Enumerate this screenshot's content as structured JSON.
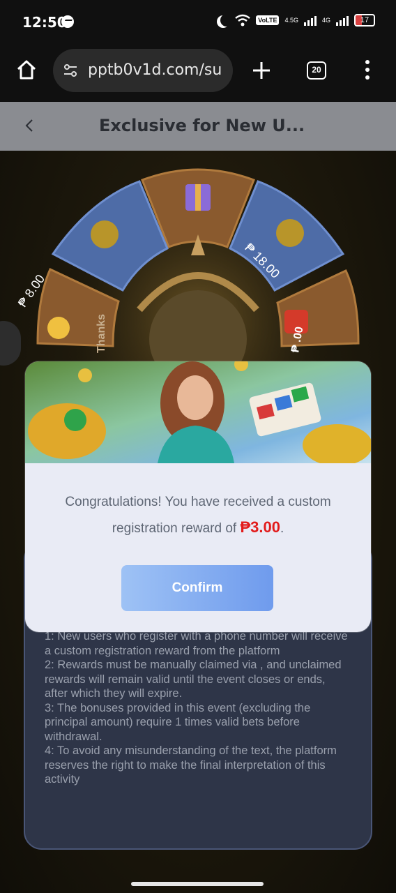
{
  "status_bar": {
    "time": "12:50",
    "volte": "VoLTE",
    "sim1_label": "4.5G",
    "sim2_label": "4G",
    "battery": "17"
  },
  "browser": {
    "url": "pptb0v1d.com/su",
    "tab_count": "20"
  },
  "header": {
    "title": "Exclusive for New U..."
  },
  "wheel": {
    "segments": [
      "₱ 8.00",
      "₱ 18.00",
      "Thanks",
      "₱ .00"
    ]
  },
  "rules": {
    "lines": [
      "1: New users who register with a phone number will receive a custom registration reward from the platform",
      "2: Rewards must be manually claimed via , and unclaimed rewards will remain valid until the event closes or ends, after which they will expire.",
      "3: The bonuses provided in this event (excluding the principal amount) require 1 times valid bets before withdrawal.",
      "4: To avoid any misunderstanding of the text, the platform reserves the right to make the final interpretation of this activity"
    ]
  },
  "modal": {
    "message": "Congratulations! You have received a custom registration reward of",
    "reward": "₱3.00",
    "period": ".",
    "confirm_label": "Confirm"
  },
  "colors": {
    "accent": "#6f9bed",
    "reward": "#e21b1b"
  }
}
